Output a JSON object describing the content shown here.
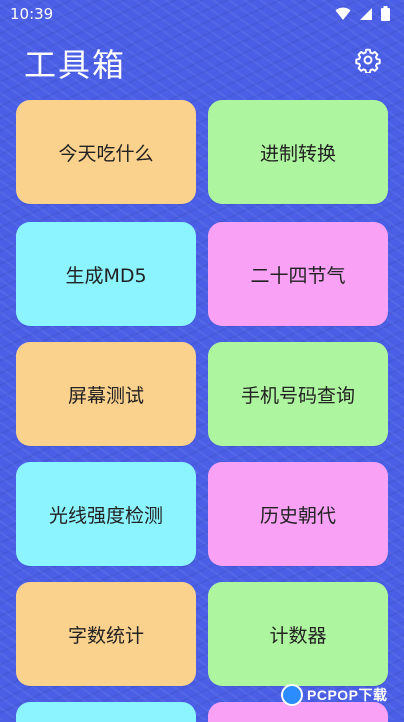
{
  "status_bar": {
    "time": "10:39",
    "icons": [
      "wifi-icon",
      "signal-icon",
      "battery-icon"
    ]
  },
  "header": {
    "title": "工具箱",
    "settings_icon": "gear-icon"
  },
  "tools": [
    {
      "label": "今天吃什么",
      "color": "#fbd18e"
    },
    {
      "label": "进制转换",
      "color": "#aef59f"
    },
    {
      "label": "生成MD5",
      "color": "#8cf4ff"
    },
    {
      "label": "二十四节气",
      "color": "#f9a2f5"
    },
    {
      "label": "屏幕测试",
      "color": "#fbd18e"
    },
    {
      "label": "手机号码查询",
      "color": "#aef59f"
    },
    {
      "label": "光线强度检测",
      "color": "#8cf4ff"
    },
    {
      "label": "历史朝代",
      "color": "#f9a2f5"
    },
    {
      "label": "字数统计",
      "color": "#fbd18e"
    },
    {
      "label": "计数器",
      "color": "#aef59f"
    }
  ],
  "colors": {
    "background": "#4a5fe6",
    "text": "#222222"
  },
  "watermark": {
    "text": "PCPOP下载"
  }
}
